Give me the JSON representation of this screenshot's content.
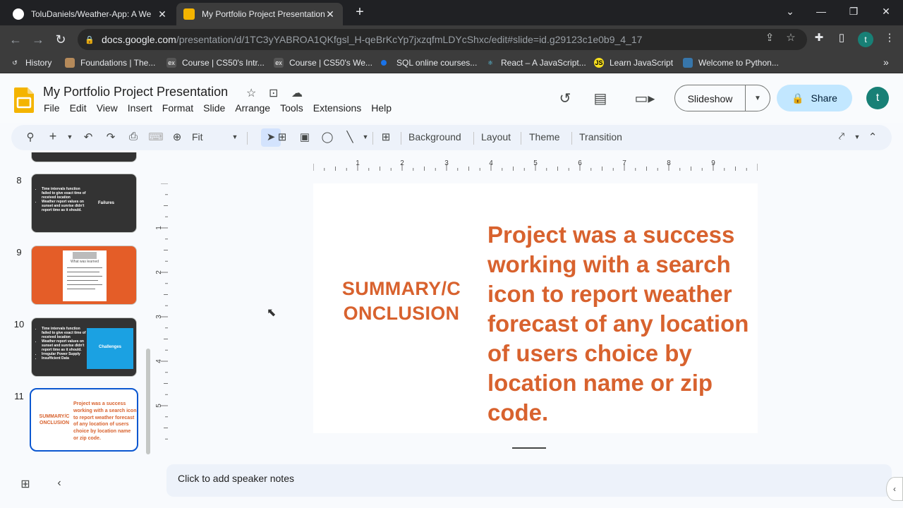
{
  "browser": {
    "tabs": [
      {
        "title": "ToluDaniels/Weather-App: A We",
        "active": false,
        "icon": "github-icon"
      },
      {
        "title": "My Portfolio Project Presentation",
        "active": true,
        "icon": "slides-icon"
      }
    ],
    "url_host": "docs.google.com",
    "url_path": "/presentation/d/1TC3yYABROA1QKfgsl_H-qeBrKcYp7jxzqfmLDYcShxc/edit#slide=id.g29123c1e0b9_4_17",
    "profile_initial": "t",
    "bookmarks": [
      "History",
      "Foundations | The...",
      "Course | CS50's Intr...",
      "Course | CS50's We...",
      "SQL online courses...",
      "React – A JavaScript...",
      "Learn JavaScript",
      "Welcome to Python..."
    ]
  },
  "app": {
    "title": "My Portfolio Project Presentation",
    "menu": [
      "File",
      "Edit",
      "View",
      "Insert",
      "Format",
      "Slide",
      "Arrange",
      "Tools",
      "Extensions",
      "Help"
    ],
    "slideshow_label": "Slideshow",
    "share_label": "Share",
    "avatar_initial": "t",
    "accent_color": "#0b57d0"
  },
  "toolbar": {
    "zoom_label": "Fit",
    "buttons": [
      "Background",
      "Layout",
      "Theme",
      "Transition"
    ]
  },
  "filmstrip": {
    "slides": [
      {
        "number": "8",
        "bullets": [
          "Time intervals function failed to give exact time of received location",
          "Weather report values on sunset and sunrise didn't report time as it should."
        ],
        "label": "Failures"
      },
      {
        "number": "9",
        "heading": "What was learned"
      },
      {
        "number": "10",
        "bullets": [
          "Time intervals function failed to give exact time of received location",
          "Weather report values on sunset and sunrise didn't report time as it should.",
          "Irregular Power Supply",
          "Insufficient Data"
        ],
        "label": "Challenges"
      },
      {
        "number": "11",
        "left": "SUMMARY/C ONCLUSION",
        "right": "Project was a success working with a search icon to report weather forecast of any location of users choice by location name or zip code."
      }
    ]
  },
  "slide": {
    "left_line1": "SUMMARY/C",
    "left_line2": "ONCLUSION",
    "body": "Project was a success working with a search icon to report weather forecast of any location of users choice by location name or zip code.",
    "accent_color": "#d8622e"
  },
  "ruler": {
    "h_labels": [
      "1",
      "2",
      "3",
      "4",
      "5",
      "6",
      "7",
      "8",
      "9"
    ],
    "v_labels": [
      "1",
      "2",
      "3",
      "4",
      "5"
    ]
  },
  "notes": {
    "placeholder": "Click to add speaker notes"
  }
}
